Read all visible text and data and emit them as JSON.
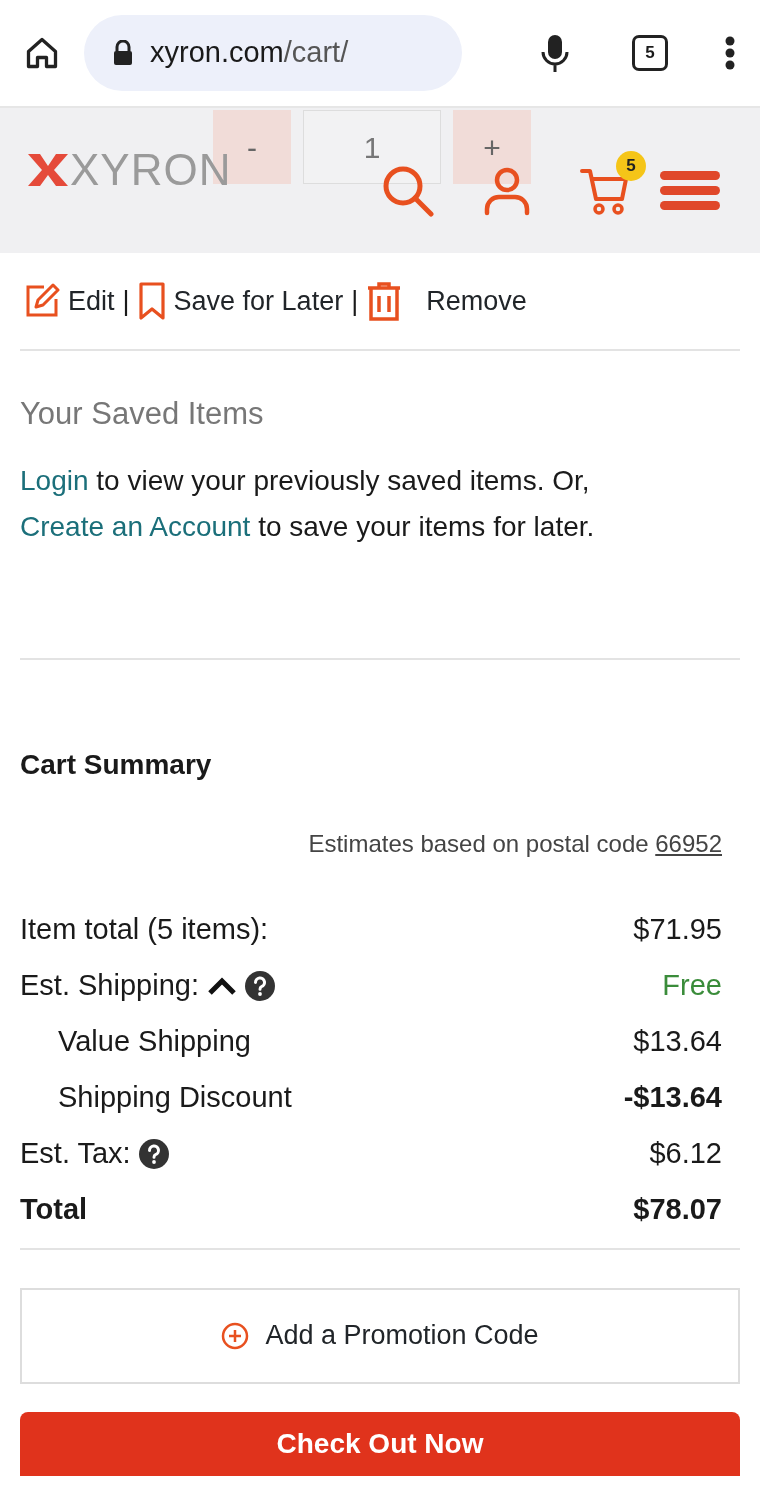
{
  "browser": {
    "url_host": "xyron.com",
    "url_path": "/cart/",
    "tab_count": "5"
  },
  "header": {
    "logo": "XYRON",
    "cart_count": "5"
  },
  "quantity": {
    "minus": "-",
    "value": "1",
    "plus": "+"
  },
  "item_actions": [
    {
      "kind": "edit",
      "label": "Edit"
    },
    {
      "kind": "separator",
      "label": "|"
    },
    {
      "kind": "save",
      "label": "Save for Later"
    },
    {
      "kind": "separator",
      "label": "|"
    },
    {
      "kind": "remove",
      "label": "Remove"
    }
  ],
  "saved_items": {
    "title": "Your Saved Items",
    "text": "to view your previously saved items. Or,",
    "login_link": "Login",
    "create_link": "Create an Account",
    "text2": "to save your items for later."
  },
  "cart_summary": {
    "title": "Cart Summary",
    "estimate_text": "Estimates based on postal code",
    "postal_code": "66952",
    "rows": [
      {
        "kind": "line",
        "label": "Item total (5 items):",
        "value": "$71.95",
        "bold": false,
        "green": false,
        "help": false
      },
      {
        "kind": "line",
        "label": "Est. Shipping:",
        "value": "Free",
        "bold": false,
        "green": true,
        "expanded": true,
        "help": true
      },
      {
        "kind": "sub",
        "label": "Value Shipping",
        "value": "$13.64",
        "bold": false,
        "green": false,
        "help": false
      },
      {
        "kind": "sub",
        "label": "Shipping Discount",
        "value": "-$13.64",
        "bold": true,
        "green": false,
        "help": false
      },
      {
        "kind": "line",
        "label": "Est. Tax:",
        "value": "$6.12",
        "bold": false,
        "green": false,
        "help": true
      },
      {
        "kind": "total",
        "label": "Total",
        "value": "$78.07",
        "green": false,
        "help": false
      }
    ],
    "promo_button": "Add a Promotion Code",
    "checkout_button": "Check Out Now"
  }
}
